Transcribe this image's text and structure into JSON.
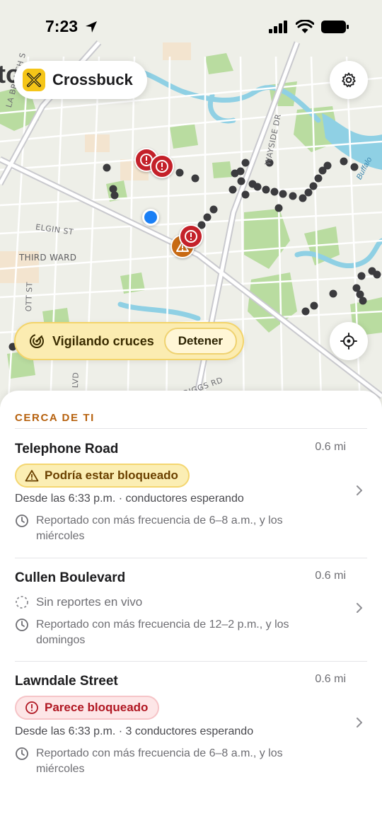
{
  "status_bar": {
    "time": "7:23"
  },
  "app": {
    "name": "Crossbuck"
  },
  "map": {
    "labels": {
      "elgin": "ELGIN ST",
      "third_ward": "THIRD WARD",
      "wayside": "WAYSIDE DR",
      "branch": "LA BRANCH S",
      "scott": "OTT ST",
      "lvd": "LVD",
      "griggs": "RIGGS RD",
      "buffalo": "Buffalo",
      "partial_city": "to"
    }
  },
  "watch": {
    "label": "Vigilando cruces",
    "stop_label": "Detener"
  },
  "nearby": {
    "title": "CERCA DE TI",
    "crossings": [
      {
        "name": "Telephone Road",
        "distance": "0.6 mi",
        "status": "Podría estar bloqueado",
        "since": "Desde las 6:33 p.m. · conductores esperando",
        "pattern": "Reportado con más frecuencia de 6–8 a.m., y los miércoles"
      },
      {
        "name": "Cullen Boulevard",
        "distance": "0.6 mi",
        "status": "Sin reportes en vivo",
        "pattern": "Reportado con más frecuencia de 12–2 p.m., y los domingos"
      },
      {
        "name": "Lawndale Street",
        "distance": "0.6 mi",
        "status": "Parece bloqueado",
        "since": "Desde las 6:33 p.m. · 3 conductores esperando",
        "pattern": "Reportado con más frecuencia de 6–8 a.m., y los miércoles"
      }
    ]
  },
  "colors": {
    "accent": "#f5c518",
    "section": "#b7620f",
    "danger": "#c4212a",
    "warning": "#c86a14",
    "location": "#1a7ff5"
  },
  "icons": [
    "location-arrow-icon",
    "signal-icon",
    "wifi-icon",
    "battery-icon",
    "crossbuck-logo-icon",
    "gear-icon",
    "radar-icon",
    "crosshair-icon",
    "warning-triangle-icon",
    "alert-circle-icon",
    "clock-icon",
    "dashed-circle-icon",
    "chevron-right-icon"
  ]
}
